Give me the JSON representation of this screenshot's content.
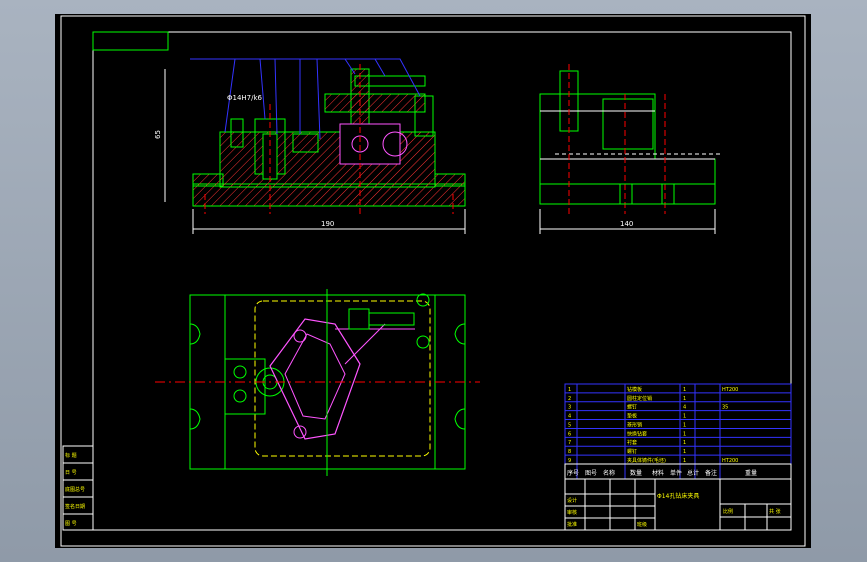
{
  "colors": {
    "background": "#000000",
    "app_frame": "#9aa5b3",
    "outline": "#ffffff",
    "part_green": "#00ff00",
    "hatch_red": "#ff3333",
    "leader_blue": "#3333ff",
    "highlight_magenta": "#ff55ff",
    "center_red": "#ff0000",
    "yellow": "#ffff00",
    "cyan": "#00ffff"
  },
  "front_view": {
    "diameter_callout": "Φ14H7/k6",
    "height_dim": "65",
    "width_dim": "190"
  },
  "side_view": {
    "width_dim": "140"
  },
  "left_strip": [
    "标 题",
    "日 号",
    "底图总号",
    "签名日期",
    "图 号"
  ],
  "bom_rows": [
    {
      "no": "1",
      "name": "钻模板",
      "qty": "1",
      "mat": "HT200"
    },
    {
      "no": "2",
      "name": "圆柱定位销",
      "qty": "1",
      "mat": ""
    },
    {
      "no": "3",
      "name": "螺钉",
      "qty": "4",
      "mat": "35"
    },
    {
      "no": "4",
      "name": "垫板",
      "qty": "1",
      "mat": ""
    },
    {
      "no": "5",
      "name": "菱形销",
      "qty": "1",
      "mat": ""
    },
    {
      "no": "6",
      "name": "快换钻套",
      "qty": "1",
      "mat": ""
    },
    {
      "no": "7",
      "name": "衬套",
      "qty": "1",
      "mat": ""
    },
    {
      "no": "8",
      "name": "螺钉",
      "qty": "1",
      "mat": ""
    },
    {
      "no": "9",
      "name": "夹具体铸件(毛坯)",
      "qty": "1",
      "mat": "HT200"
    }
  ],
  "bom_header": [
    "序号",
    "图号",
    "名称",
    "数量",
    "材料",
    "单件",
    "总计",
    "备注",
    "重量"
  ],
  "title_block": {
    "title": "Φ14孔钻床夹具",
    "scale_label": "比例",
    "sheet_label": "共 张",
    "designer": "设计",
    "checker": "审核",
    "approver": "批准",
    "school": "班级"
  }
}
